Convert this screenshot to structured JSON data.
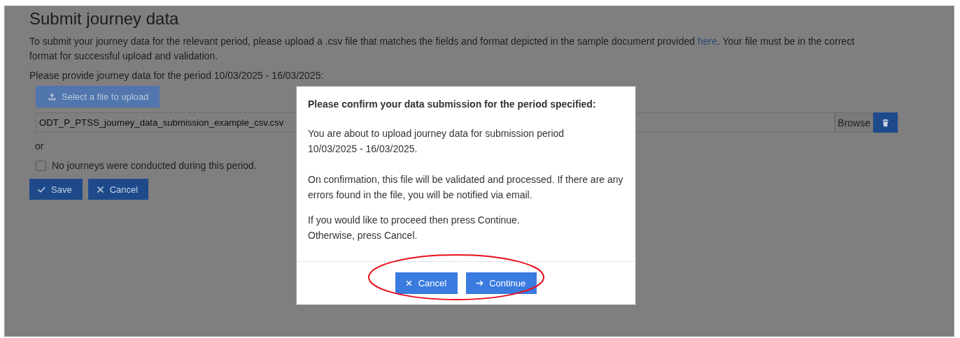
{
  "page": {
    "title": "Submit journey data",
    "intro": {
      "before": "To submit your journey data for the relevant period, please upload a .csv file that matches the fields and format depicted in the sample document provided ",
      "link": "here",
      "after": ". Your file must be in the correct format for successful upload and validation."
    },
    "period_prompt": "Please provide journey data for the period 10/03/2025 - 16/03/2025:",
    "upload_button": {
      "label": "Select a file to upload",
      "disabled": true
    },
    "file_field": {
      "value": "ODT_P_PTSS_journey_data_submission_example_csv.csv",
      "browse_label": "Browse"
    },
    "or_label": "or",
    "no_journeys": {
      "label": "No journeys were conducted during this period.",
      "checked": false
    },
    "buttons": [
      {
        "kind": "save",
        "label": "Save"
      },
      {
        "kind": "cancel",
        "label": "Cancel"
      }
    ]
  },
  "dialog": {
    "title": "Please confirm your data submission for the period specified:",
    "paragraphs": [
      [
        "You are about to upload journey data for submission period",
        "10/03/2025 - 16/03/2025."
      ],
      [
        "On confirmation, this file will be validated and processed. If there are any errors found in the file, you will be notified via email."
      ],
      [
        "If you would like to proceed then press Continue.",
        "Otherwise, press Cancel."
      ]
    ],
    "buttons": [
      {
        "kind": "cancel",
        "label": "Cancel"
      },
      {
        "kind": "continue",
        "label": "Continue"
      }
    ]
  }
}
